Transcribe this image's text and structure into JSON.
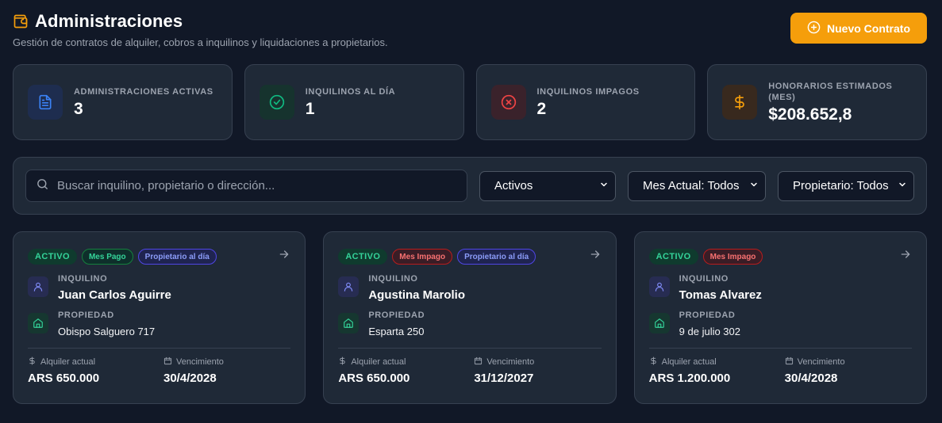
{
  "header": {
    "title": "Administraciones",
    "subtitle": "Gestión de contratos de alquiler, cobros a inquilinos y liquidaciones a propietarios.",
    "new_button_label": "Nuevo Contrato"
  },
  "stats": [
    {
      "label": "ADMINISTRACIONES ACTIVAS",
      "value": "3",
      "icon": "document-icon",
      "color": "#3b82f6"
    },
    {
      "label": "INQUILINOS AL DÍA",
      "value": "1",
      "icon": "check-circle-icon",
      "color": "#10b981"
    },
    {
      "label": "INQUILINOS IMPAGOS",
      "value": "2",
      "icon": "x-circle-icon",
      "color": "#ef4444"
    },
    {
      "label": "HONORARIOS ESTIMADOS (MES)",
      "value": "$208.652,8",
      "icon": "dollar-icon",
      "color": "#f59e0b"
    }
  ],
  "filters": {
    "search_placeholder": "Buscar inquilino, propietario o dirección...",
    "status_value": "Activos",
    "month_value": "Mes Actual: Todos",
    "owner_value": "Propietario: Todos"
  },
  "labels": {
    "tenant": "INQUILINO",
    "property": "PROPIEDAD",
    "rent": "Alquiler actual",
    "due": "Vencimiento"
  },
  "contracts": [
    {
      "status": "ACTIVO",
      "payment_badge": "Mes Pago",
      "owner_badge": "Propietario al día",
      "tenant": "Juan Carlos Aguirre",
      "property": "Obispo Salguero 717",
      "rent": "ARS 650.000",
      "due": "30/4/2028"
    },
    {
      "status": "ACTIVO",
      "payment_badge": "Mes Impago",
      "owner_badge": "Propietario al día",
      "tenant": "Agustina Marolio",
      "property": "Esparta 250",
      "rent": "ARS 650.000",
      "due": "31/12/2027"
    },
    {
      "status": "ACTIVO",
      "payment_badge": "Mes Impago",
      "owner_badge": "",
      "tenant": "Tomas Alvarez",
      "property": "9 de julio 302",
      "rent": "ARS 1.200.000",
      "due": "30/4/2028"
    }
  ],
  "colors": {
    "accent": "#f59e0b",
    "background": "#111827",
    "card": "#1f2937"
  }
}
